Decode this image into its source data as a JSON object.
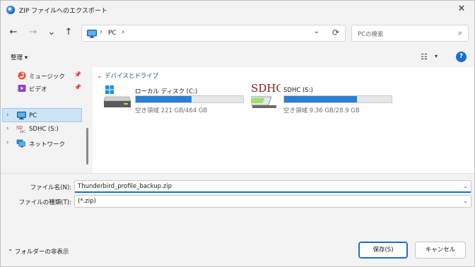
{
  "window": {
    "title": "ZIP ファイルへのエクスポート",
    "close_glyph": "✕"
  },
  "nav": {
    "back": "←",
    "forward": "→",
    "recent": "⌄",
    "up": "↑"
  },
  "address": {
    "crumb_sep": "›",
    "location": "PC",
    "trailing_sep": "›",
    "dropdown": "⌄",
    "refresh": "⟳"
  },
  "search": {
    "placeholder": "PCの検索",
    "icon": "⌕"
  },
  "toolbar": {
    "organize": "整理 ▾",
    "view_icon": "☷",
    "view_dropdown": "▾",
    "help": "?"
  },
  "sidebar": {
    "items": [
      {
        "label": "ミュージック",
        "icon": "music-icon",
        "pinned": true
      },
      {
        "label": "ビデオ",
        "icon": "video-icon",
        "pinned": true
      },
      {
        "label": "PC",
        "icon": "pc-icon",
        "selected": true,
        "expandable": true
      },
      {
        "label": "SDHC (S:)",
        "icon": "sdhc-icon",
        "expandable": true
      },
      {
        "label": "ネットワーク",
        "icon": "network-icon",
        "expandable": true
      }
    ],
    "pin_glyph": "📌",
    "chevron_glyph": "›"
  },
  "content": {
    "group_header": "デバイスとドライブ",
    "group_chevron": "⌄",
    "drives": [
      {
        "name": "ローカル ディスク (C:)",
        "space": "空き領域 221 GB/464 GB",
        "used_fraction": 0.52
      },
      {
        "name": "SDHC (S:)",
        "space": "空き領域 9.36 GB/28.9 GB",
        "used_fraction": 0.68,
        "logo": "SDHC"
      }
    ]
  },
  "form": {
    "filename_label": "ファイル名(N):",
    "filename_value": "Thunderbird_profile_backup.zip",
    "filetype_label": "ファイルの種類(T):",
    "filetype_value": "(*.zip)",
    "dropdown_glyph": "⌄"
  },
  "footer": {
    "hide_folders": "⌃  フォルダーの非表示",
    "save": "保存(S)",
    "cancel": "キャンセル"
  },
  "colors": {
    "accent": "#1a6ecf",
    "selection": "#cce4f7",
    "drive_fill": "#2a7fd4"
  }
}
